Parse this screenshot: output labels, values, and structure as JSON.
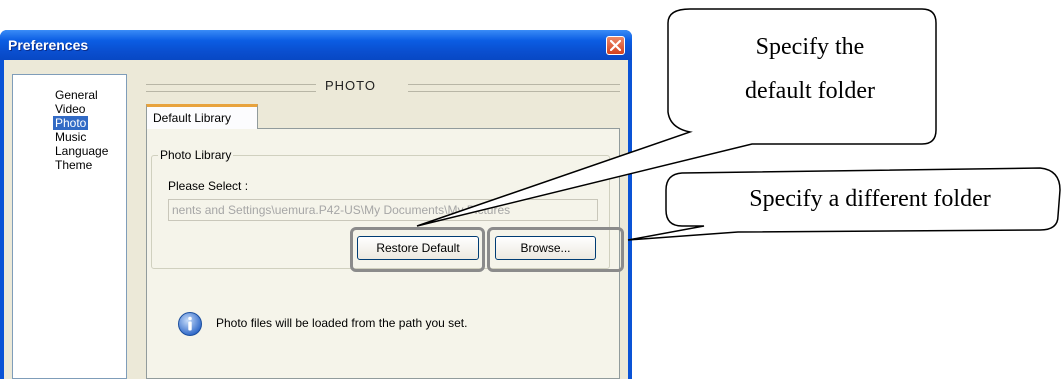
{
  "window": {
    "title": "Preferences"
  },
  "nav": {
    "items": [
      "General",
      "Video",
      "Photo",
      "Music",
      "Language",
      "Theme"
    ],
    "selected": "Photo"
  },
  "panel": {
    "heading": "PHOTO",
    "tab": "Default Library",
    "group_title": "Photo Library",
    "select_label": "Please Select :",
    "path_value": "nents and Settings\\uemura.P42-US\\My Documents\\My Pictures",
    "restore_button": "Restore Default",
    "browse_button": "Browse...",
    "info_text": "Photo files will be loaded from the path you set."
  },
  "callouts": {
    "top_line1": "Specify the",
    "top_line2": "default folder",
    "right": "Specify a different folder"
  },
  "colors": {
    "titlebar": "#0a4fd0",
    "selection": "#316ac5",
    "tab_accent": "#e8a33d",
    "highlight": "#8b8b8b"
  },
  "icons": {
    "close": "close-icon",
    "info": "info-icon"
  }
}
